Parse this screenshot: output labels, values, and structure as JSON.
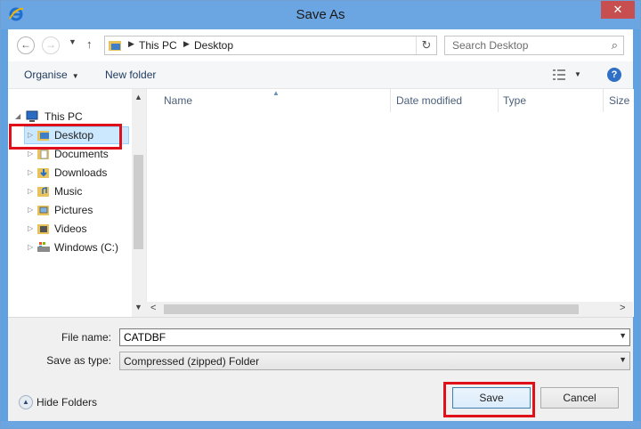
{
  "window": {
    "title": "Save As",
    "close_label": "✕"
  },
  "nav": {
    "back": "←",
    "forward": "→",
    "recent": "▼",
    "up": "↑"
  },
  "address": {
    "crumbs": [
      "This PC",
      "Desktop"
    ],
    "refresh": "↻"
  },
  "search": {
    "placeholder": "Search Desktop",
    "icon": "⌕"
  },
  "toolbar": {
    "organise_label": "Organise",
    "new_folder_label": "New folder",
    "help_label": "?"
  },
  "tree": {
    "root": "This PC",
    "items": [
      {
        "label": "Desktop",
        "icon": "desktop-folder-icon",
        "selected": true
      },
      {
        "label": "Documents",
        "icon": "documents-folder-icon"
      },
      {
        "label": "Downloads",
        "icon": "downloads-folder-icon"
      },
      {
        "label": "Music",
        "icon": "music-folder-icon"
      },
      {
        "label": "Pictures",
        "icon": "pictures-folder-icon"
      },
      {
        "label": "Videos",
        "icon": "videos-folder-icon"
      },
      {
        "label": "Windows (C:)",
        "icon": "drive-icon"
      }
    ]
  },
  "columns": [
    "Name",
    "Date modified",
    "Type",
    "Size"
  ],
  "form": {
    "file_name_label": "File name:",
    "file_name_value": "CATDBF",
    "save_type_label": "Save as type:",
    "save_type_value": "Compressed (zipped) Folder"
  },
  "footer": {
    "hide_folders_label": "Hide Folders",
    "save_label": "Save",
    "cancel_label": "Cancel"
  },
  "colors": {
    "highlight": "#e0101a",
    "titlebar": "#6ba6e3",
    "selection": "#cce8ff"
  }
}
